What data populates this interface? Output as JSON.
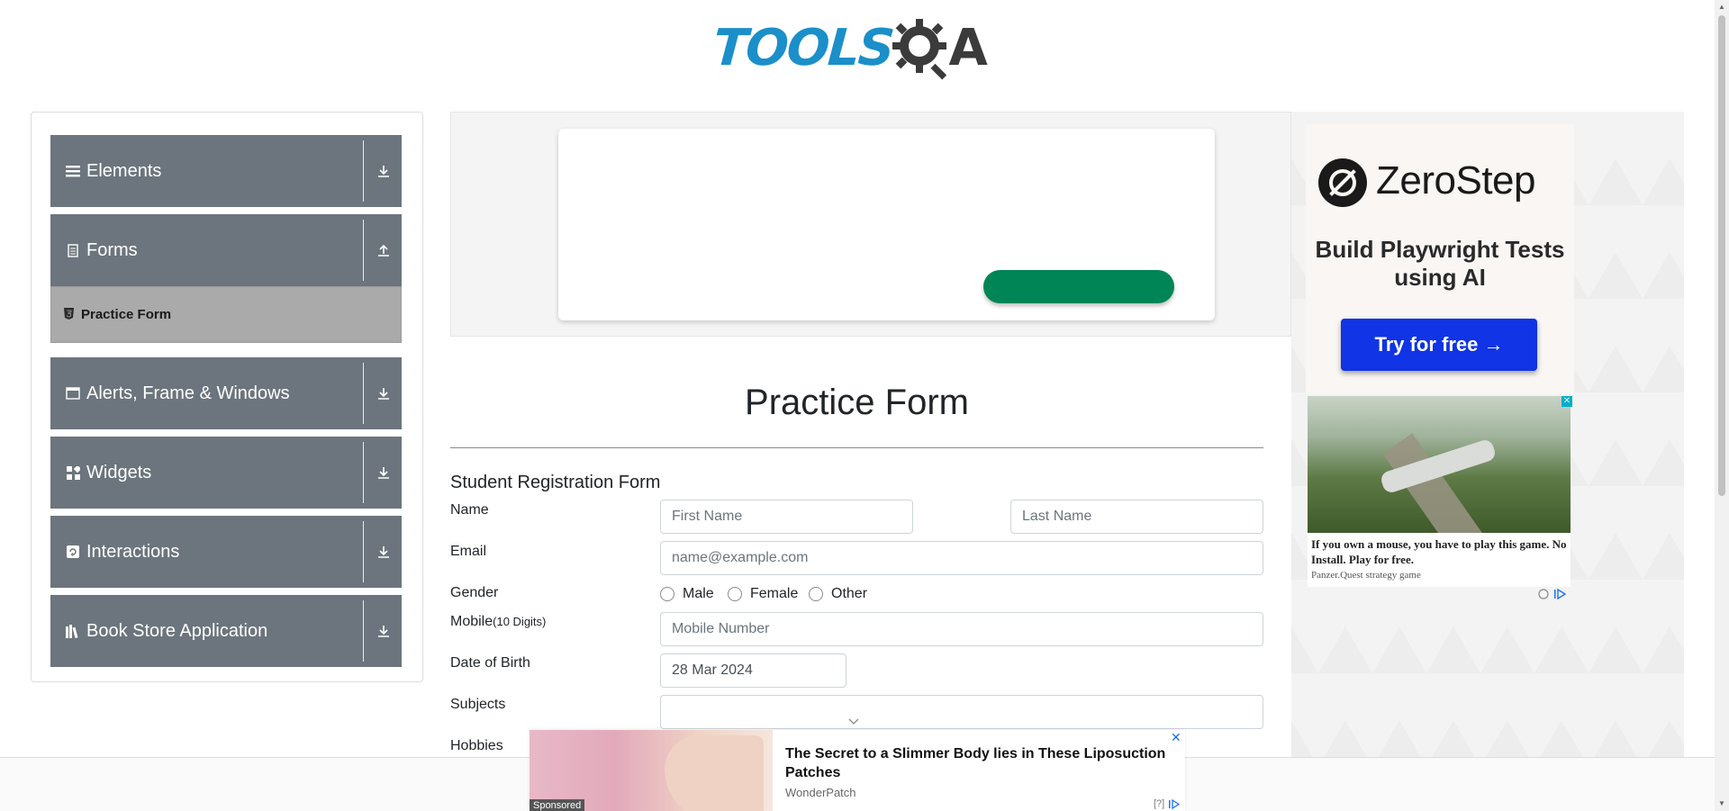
{
  "logo": {
    "left": "TOOLS",
    "right": "A"
  },
  "sidebar": {
    "groups": [
      {
        "label": "Elements",
        "icon": "hamburger-icon",
        "expanded": false
      },
      {
        "label": "Forms",
        "icon": "document-icon",
        "expanded": true
      },
      {
        "label": "Alerts, Frame & Windows",
        "icon": "window-icon",
        "expanded": false
      },
      {
        "label": "Widgets",
        "icon": "widgets-icon",
        "expanded": false
      },
      {
        "label": "Interactions",
        "icon": "interactions-icon",
        "expanded": false
      },
      {
        "label": "Book Store Application",
        "icon": "books-icon",
        "expanded": false
      }
    ],
    "forms_items": [
      {
        "label": "Practice Form",
        "icon": "html5-icon",
        "active": true
      }
    ]
  },
  "form": {
    "title": "Practice Form",
    "subtitle": "Student Registration Form",
    "labels": {
      "name": "Name",
      "email": "Email",
      "gender": "Gender",
      "mobile": "Mobile",
      "mobile_hint": "(10 Digits)",
      "dob": "Date of Birth",
      "subjects": "Subjects",
      "hobbies": "Hobbies"
    },
    "placeholders": {
      "first_name": "First Name",
      "last_name": "Last Name",
      "email": "name@example.com",
      "mobile": "Mobile Number"
    },
    "values": {
      "dob": "28 Mar 2024",
      "subjects": ""
    },
    "gender_options": [
      "Male",
      "Female",
      "Other"
    ]
  },
  "right_ad": {
    "brand": "ZeroStep",
    "tagline": "Build Playwright Tests using AI",
    "cta": "Try for free →",
    "game_title": "If you own a mouse, you have to play this game. No Install. Play for free.",
    "game_source": "Panzer.Quest strategy game",
    "close": "✕"
  },
  "bottom_ad": {
    "title": "The Secret to a Slimmer Body lies in These Liposuction Patches",
    "source": "WonderPatch",
    "sponsored": "Sponsored",
    "close": "✕",
    "info": "[?]"
  },
  "colors": {
    "sidebar_group": "#6c757d",
    "sidebar_active": "#aaaaaa",
    "cta_blue": "#1034e6",
    "ad_green": "#008556",
    "logo_blue": "#1b8fc9"
  }
}
